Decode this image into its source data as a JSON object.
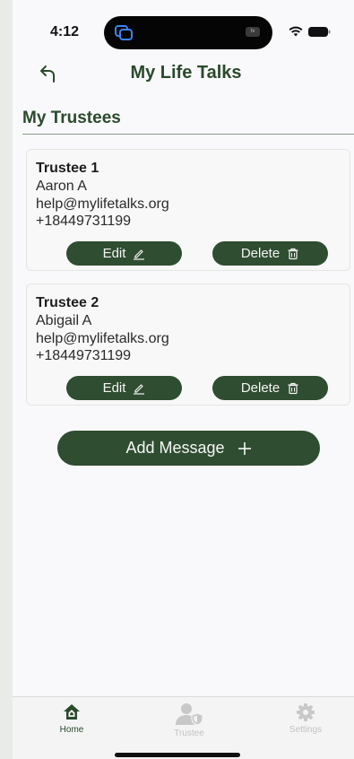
{
  "status_bar": {
    "time": "4:12",
    "tv_badge": "tv"
  },
  "header": {
    "title": "My Life Talks"
  },
  "section": {
    "title": "My Trustees"
  },
  "trustees": [
    {
      "heading": "Trustee 1",
      "name": "Aaron A",
      "email": "help@mylifetalks.org",
      "phone": "+18449731199",
      "edit_label": "Edit",
      "delete_label": "Delete"
    },
    {
      "heading": "Trustee 2",
      "name": "Abigail A",
      "email": "help@mylifetalks.org",
      "phone": "+18449731199",
      "edit_label": "Edit",
      "delete_label": "Delete"
    }
  ],
  "actions": {
    "add_message_label": "Add Message"
  },
  "tab_bar": {
    "home": "Home",
    "trustee": "Trustee",
    "settings": "Settings"
  },
  "colors": {
    "brand_green": "#2f4d31",
    "title_green": "#2b4a2c",
    "inactive_tab": "#c2c2c2"
  },
  "icons": {
    "back": "back-arrow-icon",
    "edit": "pencil-icon",
    "delete": "trash-icon",
    "add": "plus-icon",
    "home": "home-icon",
    "trustee": "person-shield-icon",
    "settings": "gear-icon"
  }
}
